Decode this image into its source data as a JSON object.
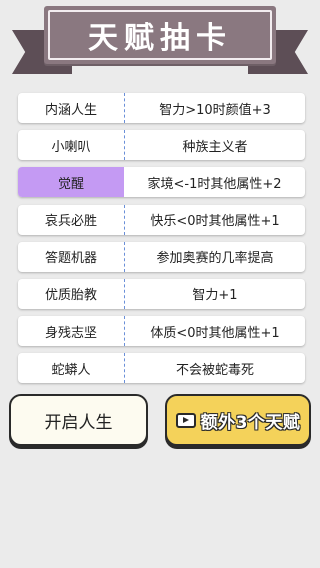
{
  "header": {
    "title": "天赋抽卡"
  },
  "talents": [
    {
      "name": "内涵人生",
      "desc": "智力>10时颜值+3",
      "selected": false
    },
    {
      "name": "小喇叭",
      "desc": "种族主义者",
      "selected": false
    },
    {
      "name": "觉醒",
      "desc": "家境<-1时其他属性+2",
      "selected": true
    },
    {
      "name": "哀兵必胜",
      "desc": "快乐<0时其他属性+1",
      "selected": false
    },
    {
      "name": "答题机器",
      "desc": "参加奥赛的几率提高",
      "selected": false
    },
    {
      "name": "优质胎教",
      "desc": "智力+1",
      "selected": false
    },
    {
      "name": "身残志坚",
      "desc": "体质<0时其他属性+1",
      "selected": false
    },
    {
      "name": "蛇蟒人",
      "desc": "不会被蛇毒死",
      "selected": false
    }
  ],
  "buttons": {
    "start_label": "开启人生",
    "extra_label": "额外3个天赋",
    "extra_icon": "video-play-icon"
  },
  "colors": {
    "background": "#ebebeb",
    "ribbon": "#8a7880",
    "selected": "#c49af3",
    "extra_button": "#f4d25a"
  }
}
